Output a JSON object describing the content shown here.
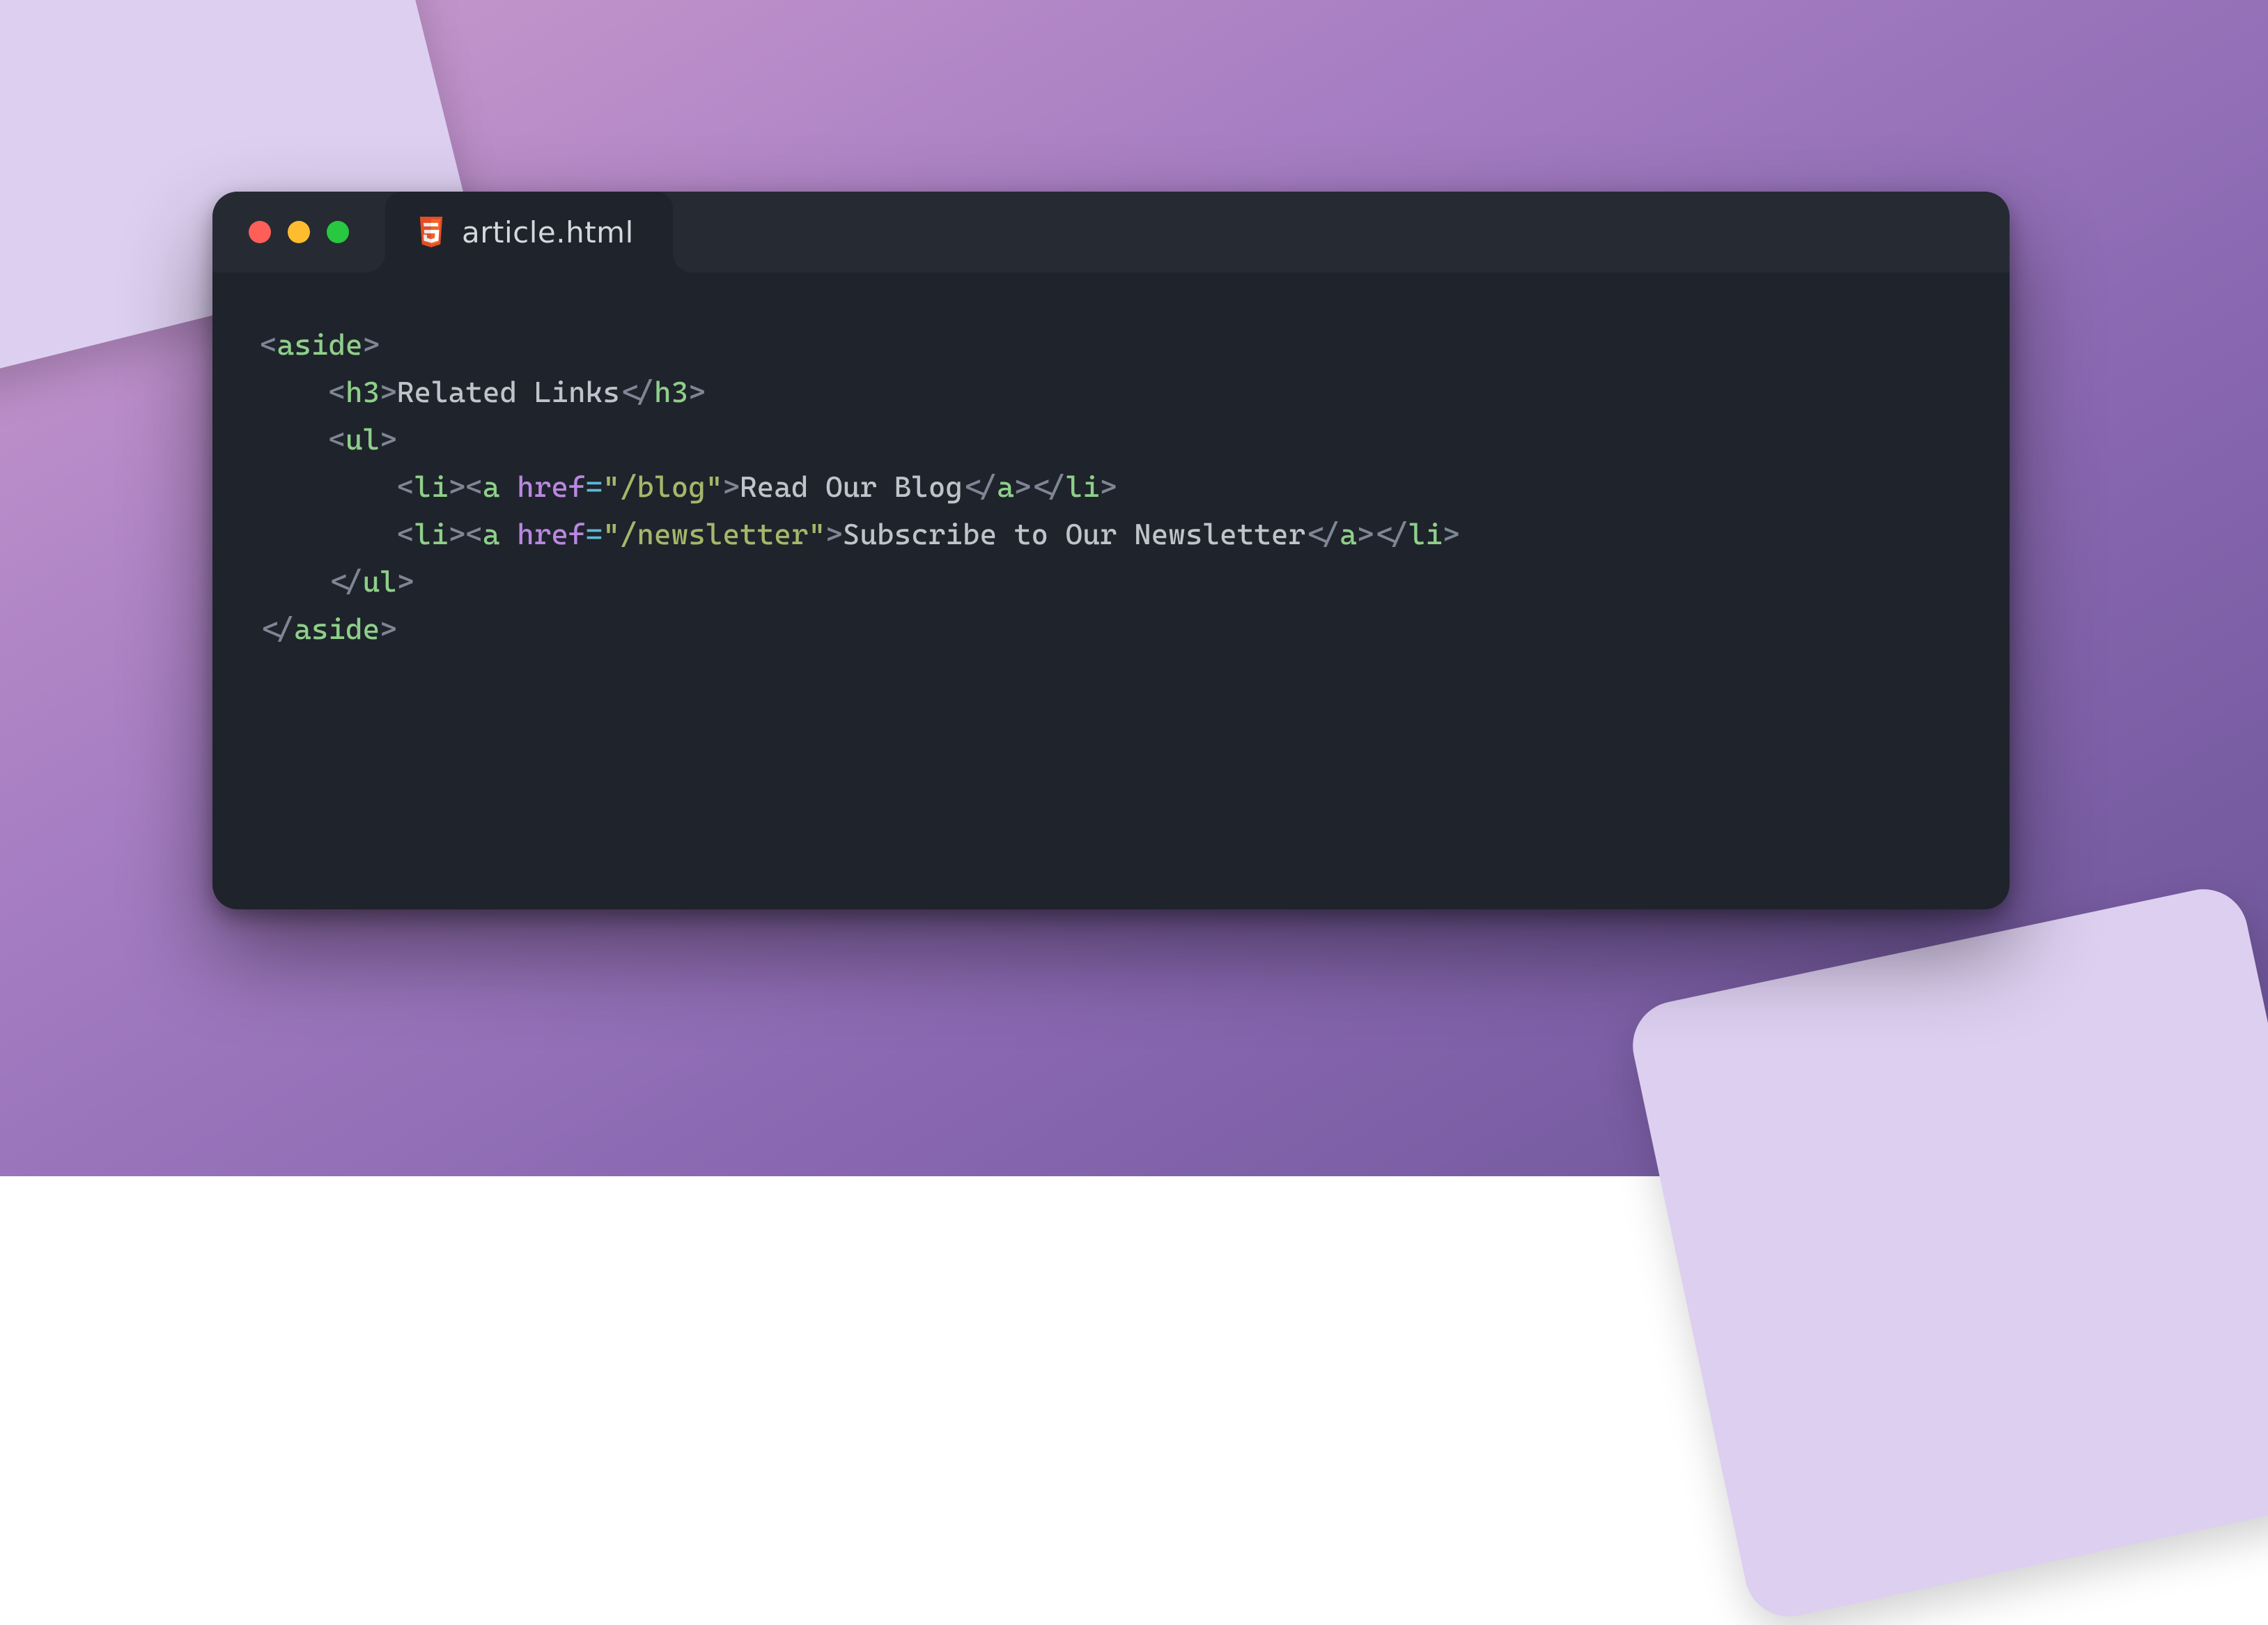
{
  "tab": {
    "filename": "article.html",
    "icon": "html5-icon"
  },
  "window": {
    "controls": [
      "close",
      "minimize",
      "zoom"
    ]
  },
  "syntax_colors": {
    "punctuation": "#7d8694",
    "tag": "#8ecf8a",
    "attribute": "#b987e0",
    "equals": "#5dbad5",
    "string": "#a2b86a",
    "text": "#bfc4cb",
    "editor_bg": "#1f232b",
    "titlebar_bg": "#262b33"
  },
  "code": {
    "tags": {
      "aside": "aside",
      "h3": "h3",
      "ul": "ul",
      "li": "li",
      "a": "a"
    },
    "attr_href": "href",
    "heading_text": "Related Links",
    "links": [
      {
        "href": "\"/blog\"",
        "text": "Read Our Blog"
      },
      {
        "href": "\"/newsletter\"",
        "text": "Subscribe to Our Newsletter"
      }
    ],
    "raw": "<aside>\n    <h3>Related Links</h3>\n    <ul>\n        <li><a href=\"/blog\">Read Our Blog</a></li>\n        <li><a href=\"/newsletter\">Subscribe to Our Newsletter</a></li>\n    </ul>\n</aside>"
  }
}
